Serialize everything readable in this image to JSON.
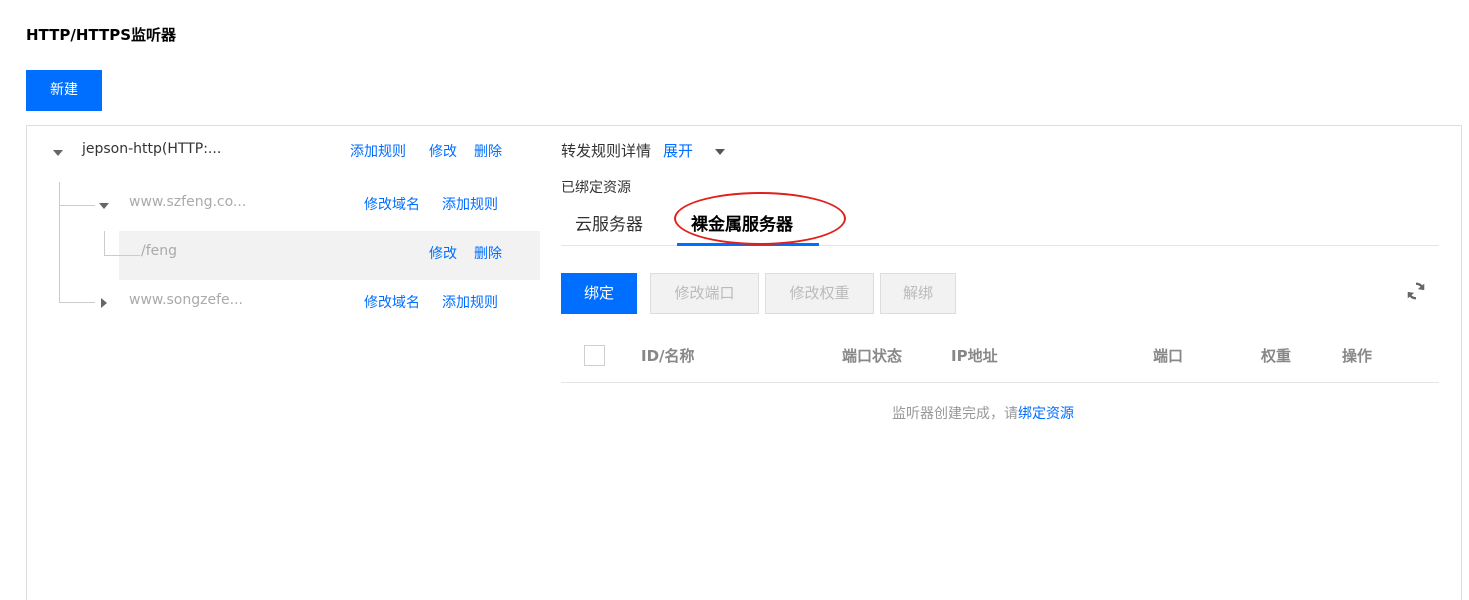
{
  "page": {
    "title": "HTTP/HTTPS监听器",
    "new_button": "新建"
  },
  "tree": {
    "root": {
      "label": "jepson-http(HTTP:...",
      "actions": [
        "添加规则",
        "修改",
        "删除"
      ]
    },
    "domains": [
      {
        "label": "www.szfeng.co...",
        "expanded": true,
        "actions": [
          "修改域名",
          "添加规则"
        ],
        "rules": [
          {
            "label": "/feng",
            "actions": [
              "修改",
              "删除"
            ]
          }
        ]
      },
      {
        "label": "www.songzefe...",
        "expanded": false,
        "actions": [
          "修改域名",
          "添加规则"
        ]
      }
    ]
  },
  "detail": {
    "rule_details_label": "转发规则详情",
    "expand_link": "展开",
    "bound_resources_label": "已绑定资源",
    "tabs": [
      {
        "label": "云服务器",
        "active": false
      },
      {
        "label": "裸金属服务器",
        "active": true
      }
    ],
    "toolbar": {
      "bind": "绑定",
      "modify_port": "修改端口",
      "modify_weight": "修改权重",
      "unbind": "解绑"
    },
    "table": {
      "columns": [
        "ID/名称",
        "端口状态",
        "IP地址",
        "端口",
        "权重",
        "操作"
      ]
    },
    "empty_state": {
      "message": "监听器创建完成，请",
      "link": "绑定资源"
    }
  },
  "colors": {
    "primary": "#006eff",
    "annotation": "#e0201b",
    "selected_row_bg": "#f2f2f2"
  }
}
